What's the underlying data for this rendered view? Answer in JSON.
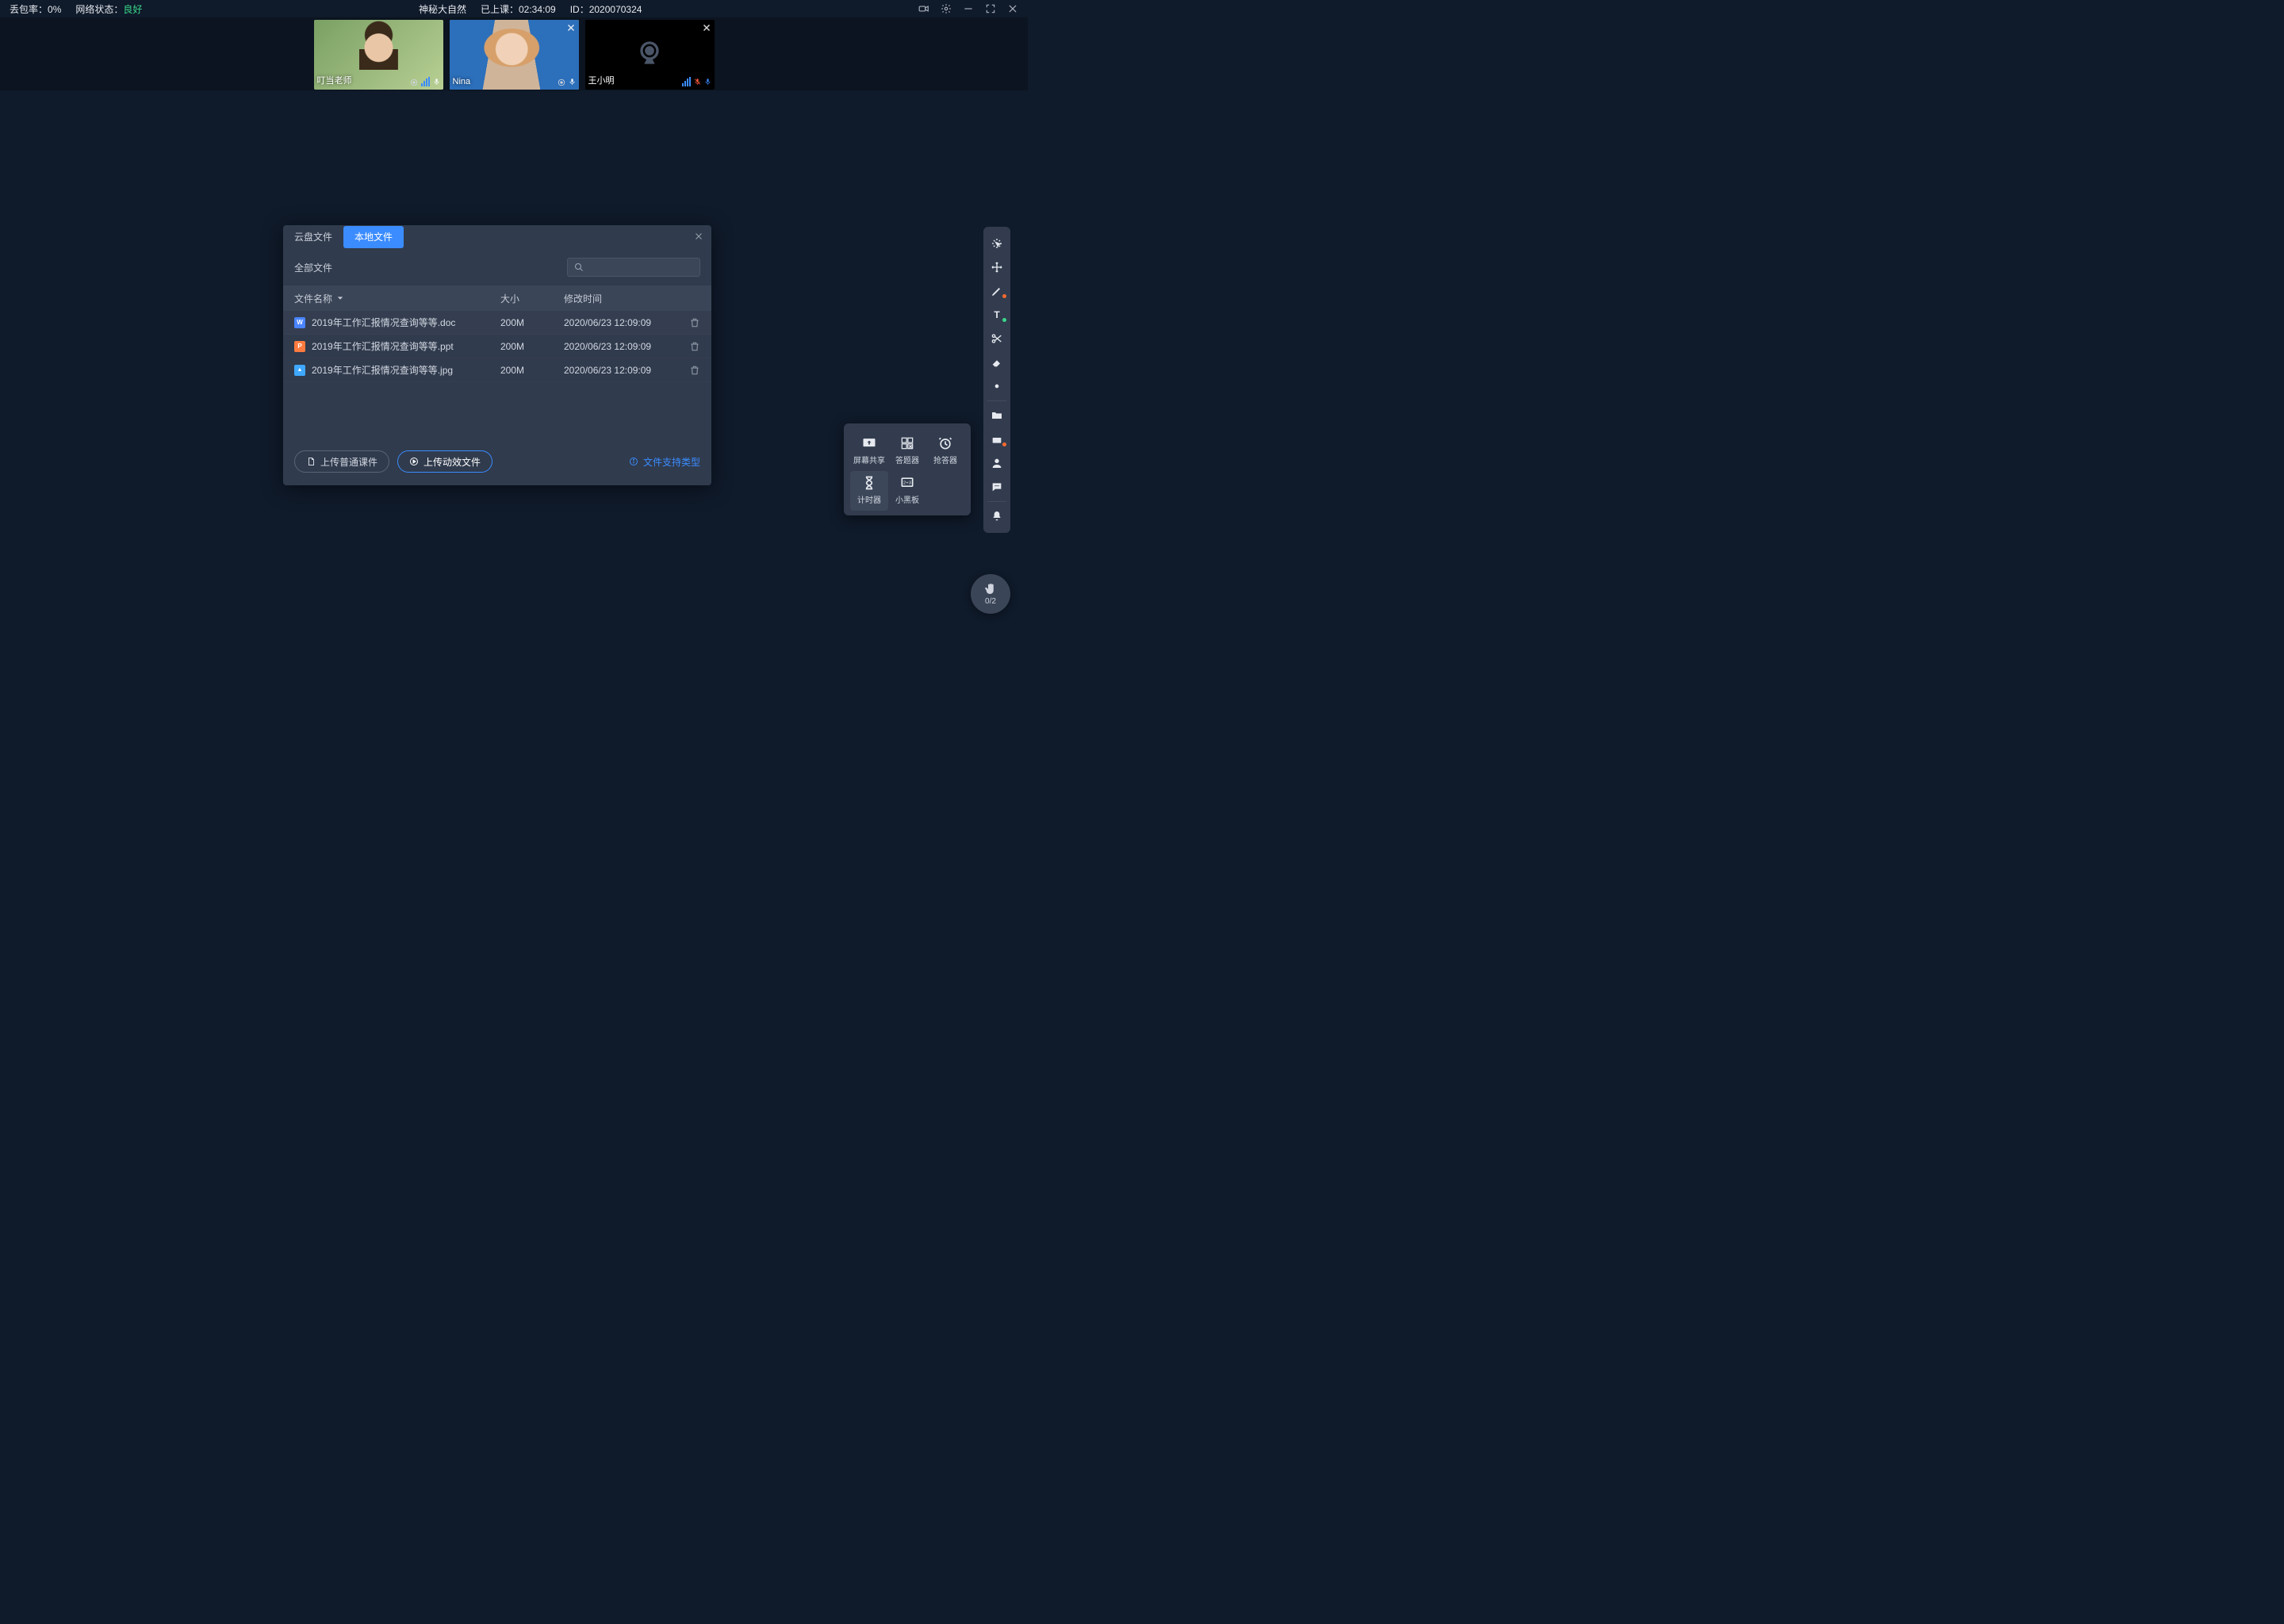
{
  "top": {
    "loss_label": "丢包率：",
    "loss_value": "0%",
    "net_label": "网络状态：",
    "net_value": "良好",
    "title": "神秘大自然",
    "time_label": "已上课：",
    "time_value": "02:34:09",
    "id_label": "ID：",
    "id_value": "2020070324"
  },
  "videos": [
    {
      "name": "叮当老师",
      "camera": "on",
      "bars": true,
      "mic": "on"
    },
    {
      "name": "Nina",
      "camera": "on",
      "bars": false,
      "mic": "on",
      "pinned": true
    },
    {
      "name": "王小明",
      "camera": "off",
      "bars": true,
      "mic": "muted",
      "pinned": true
    }
  ],
  "modal": {
    "tabs": [
      "云盘文件",
      "本地文件"
    ],
    "active_tab": 1,
    "all_files": "全部文件",
    "col_name": "文件名称",
    "col_size": "大小",
    "col_mtime": "修改时间",
    "rows": [
      {
        "icon": "w",
        "label": "W",
        "name": "2019年工作汇报情况查询等等.doc",
        "size": "200M",
        "mtime": "2020/06/23 12:09:09"
      },
      {
        "icon": "p",
        "label": "P",
        "name": "2019年工作汇报情况查询等等.ppt",
        "size": "200M",
        "mtime": "2020/06/23 12:09:09"
      },
      {
        "icon": "i",
        "label": "▲",
        "name": "2019年工作汇报情况查询等等.jpg",
        "size": "200M",
        "mtime": "2020/06/23 12:09:09"
      }
    ],
    "btn_upload": "上传普通课件",
    "btn_upload_fx": "上传动效文件",
    "support": "文件支持类型"
  },
  "popup": {
    "items": [
      {
        "id": "screen-share",
        "label": "屏幕共享"
      },
      {
        "id": "answer",
        "label": "答题器"
      },
      {
        "id": "buzz",
        "label": "抢答器"
      },
      {
        "id": "timer",
        "label": "计时器",
        "selected": true
      },
      {
        "id": "blackboard",
        "label": "小黑板"
      }
    ]
  },
  "rail": [
    {
      "id": "laser"
    },
    {
      "id": "move"
    },
    {
      "id": "pen",
      "dot": "o"
    },
    {
      "id": "text",
      "dot": "g"
    },
    {
      "id": "scissors"
    },
    {
      "id": "eraser"
    },
    {
      "id": "brightness"
    },
    {
      "sep": true
    },
    {
      "id": "folder"
    },
    {
      "id": "toolbox",
      "dot": "o"
    },
    {
      "id": "user"
    },
    {
      "id": "chat"
    },
    {
      "sep": true
    },
    {
      "id": "bell"
    }
  ],
  "fab": {
    "count": "0/2"
  }
}
